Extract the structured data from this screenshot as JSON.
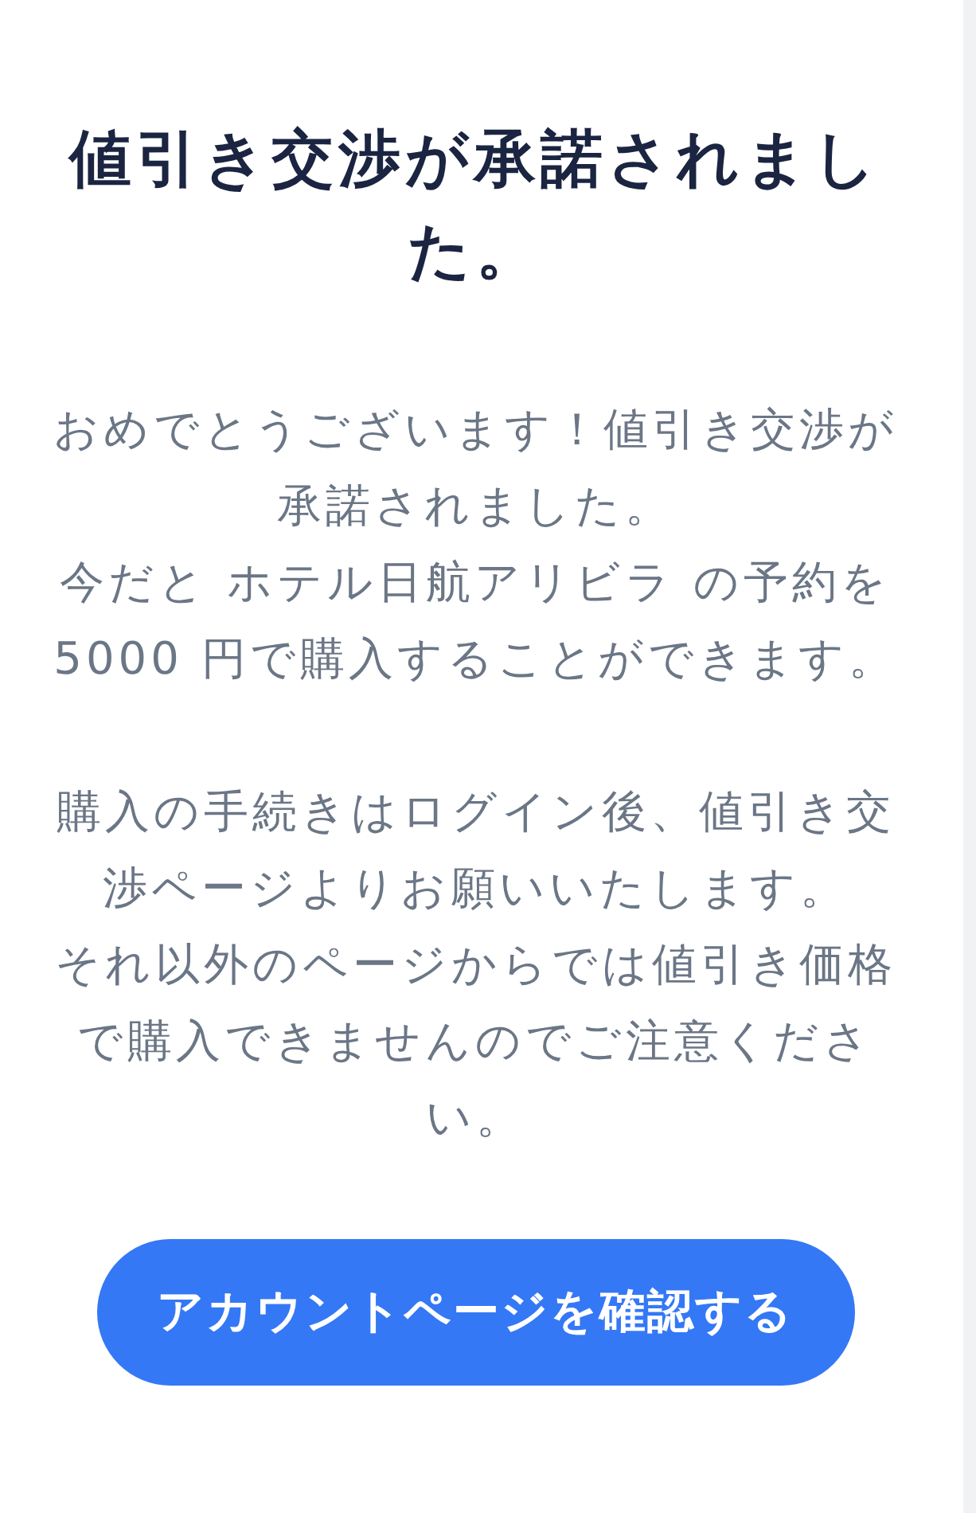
{
  "title": "値引き交渉が承諾されました。",
  "paragraphs": [
    {
      "lines": [
        "おめでとうございます！値引き交渉が承諾されました。",
        "今だと ホテル日航アリビラ の予約を 5000 円で購入することができます。"
      ]
    },
    {
      "lines": [
        "購入の手続きはログイン後、値引き交渉ページよりお願いいたします。",
        "それ以外のページからでは値引き価格で購入できませんのでご注意ください。"
      ]
    }
  ],
  "button": {
    "label": "アカウントページを確認する"
  }
}
